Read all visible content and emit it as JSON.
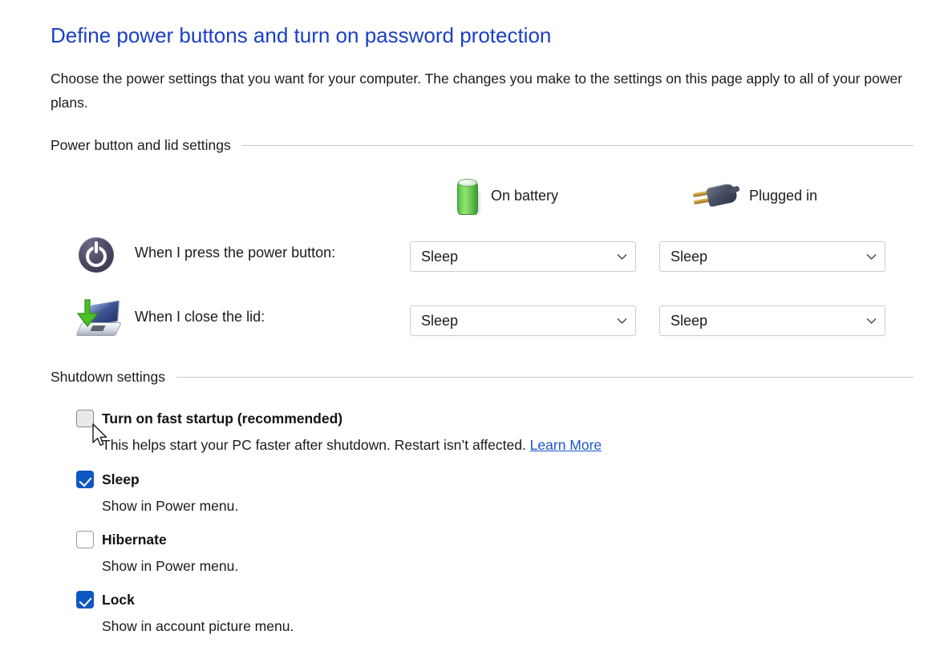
{
  "page": {
    "title": "Define power buttons and turn on password protection",
    "description": "Choose the power settings that you want for your computer. The changes you make to the settings on this page apply to all of your power plans.",
    "title_color": "#1a3fc4",
    "link_color": "#1a56cc",
    "accent_color": "#0f57c1"
  },
  "groups": {
    "power_lid": {
      "label": "Power button and lid settings"
    },
    "shutdown": {
      "label": "Shutdown settings"
    }
  },
  "columns": [
    {
      "id": "on-battery",
      "label": "On battery",
      "icon": "battery-icon"
    },
    {
      "id": "plugged-in",
      "label": "Plugged in",
      "icon": "power-plug-icon"
    }
  ],
  "settings": [
    {
      "id": "power-button",
      "label": "When I press the power button:",
      "icon": "power-button-icon",
      "on_battery": "Sleep",
      "plugged_in": "Sleep"
    },
    {
      "id": "close-lid",
      "label": "When I close the lid:",
      "icon": "laptop-lid-icon",
      "on_battery": "Sleep",
      "plugged_in": "Sleep"
    }
  ],
  "shutdown_options": [
    {
      "id": "fast-startup",
      "title": "Turn on fast startup (recommended)",
      "checked": false,
      "hovered": true,
      "description": "This helps start your PC faster after shutdown. Restart isn’t affected. ",
      "link": "Learn More"
    },
    {
      "id": "sleep",
      "title": "Sleep",
      "checked": true,
      "hovered": false,
      "description": "Show in Power menu.",
      "link": ""
    },
    {
      "id": "hibernate",
      "title": "Hibernate",
      "checked": false,
      "hovered": false,
      "description": "Show in Power menu.",
      "link": ""
    },
    {
      "id": "lock",
      "title": "Lock",
      "checked": true,
      "hovered": false,
      "description": "Show in account picture menu.",
      "link": ""
    }
  ]
}
